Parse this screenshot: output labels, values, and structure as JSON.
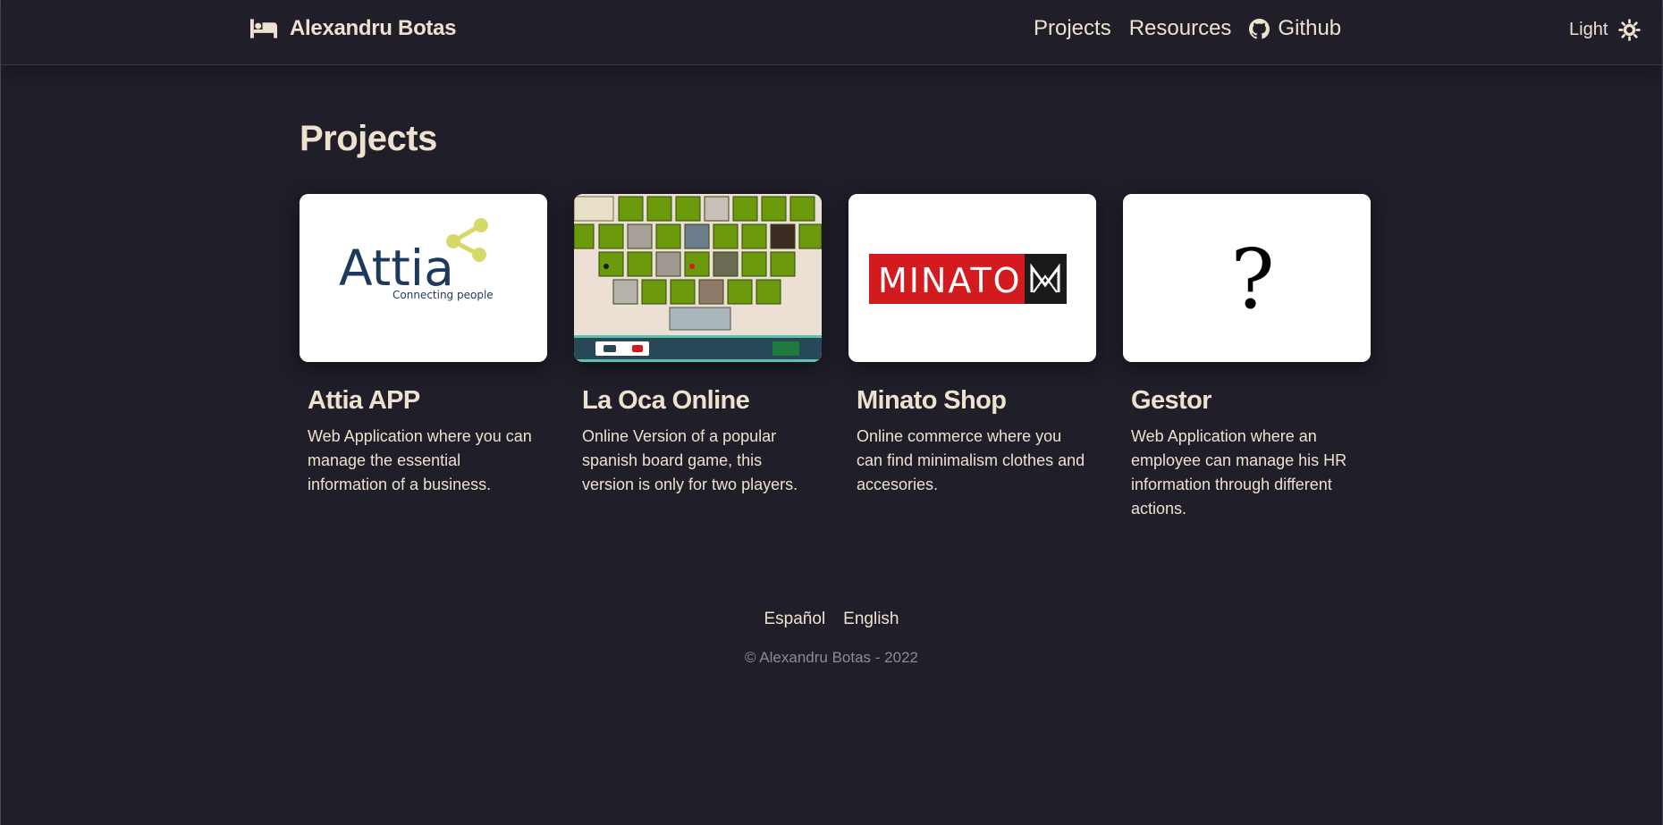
{
  "header": {
    "brand_name": "Alexandru Botas",
    "nav": {
      "projects": "Projects",
      "resources": "Resources",
      "github": "Github"
    },
    "theme_label": "Light"
  },
  "main": {
    "title": "Projects",
    "cards": [
      {
        "title": "Attia APP",
        "description": "Web Application where you can manage the essential information of a business.",
        "logo_text": "Attia",
        "logo_tagline": "Connecting people"
      },
      {
        "title": "La Oca Online",
        "description": "Online Version of a popular spanish board game, this version is only for two players."
      },
      {
        "title": "Minato Shop",
        "description": "Online commerce where you can find minimalism clothes and accesories.",
        "logo_text": "MINATO"
      },
      {
        "title": "Gestor",
        "description": "Web Application where an employee can manage his HR information through different actions.",
        "logo_text": "?"
      }
    ]
  },
  "footer": {
    "lang_es": "Español",
    "lang_en": "English",
    "copyright": "© Alexandru Botas - 2022"
  },
  "colors": {
    "background": "#1f1e29",
    "text": "#efe1cf",
    "muted": "#8f8b93",
    "minato_red": "#d31a1f",
    "oca_green": "#6a9a0c",
    "attia_navy": "#1d3a5c",
    "attia_yellow": "#d7d86a"
  }
}
